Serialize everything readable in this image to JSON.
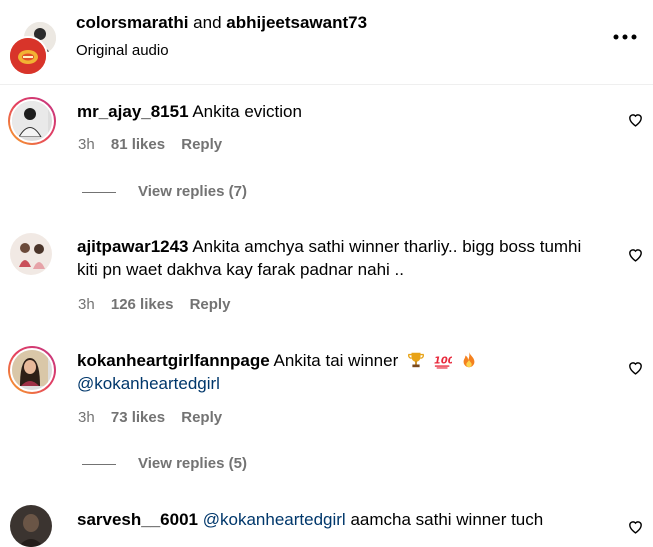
{
  "header": {
    "user1": "colorsmarathi",
    "and_text": "and",
    "user2": "abhijeetsawant73",
    "subtitle": "Original audio",
    "more_icon": "more-horizontal-icon"
  },
  "comments": [
    {
      "username": "mr_ajay_8151",
      "text": "Ankita eviction",
      "time": "3h",
      "likes": "81 likes",
      "reply": "Reply",
      "view_replies": "View replies (7)"
    },
    {
      "username": "ajitpawar1243",
      "text": "Ankita amchya sathi winner tharliy.. bigg boss tumhi kiti pn waet dakhva kay farak padnar nahi ..",
      "time": "3h",
      "likes": "126 likes",
      "reply": "Reply"
    },
    {
      "username": "kokanheartgirlfannpage",
      "text": "Ankita tai winner",
      "mention": "@kokanheartedgirl",
      "emojis": [
        "trophy-emoji",
        "hundred-points-emoji",
        "fire-emoji"
      ],
      "time": "3h",
      "likes": "73 likes",
      "reply": "Reply",
      "view_replies": "View replies (5)"
    },
    {
      "username": "sarvesh__6001",
      "mention": "@kokanheartedgirl",
      "text": "aamcha sathi winner tuch"
    }
  ],
  "colors": {
    "mention": "#00376b",
    "secondary_text": "#737373",
    "story_ring_start": "#f9a825",
    "story_ring_end": "#c13584"
  }
}
